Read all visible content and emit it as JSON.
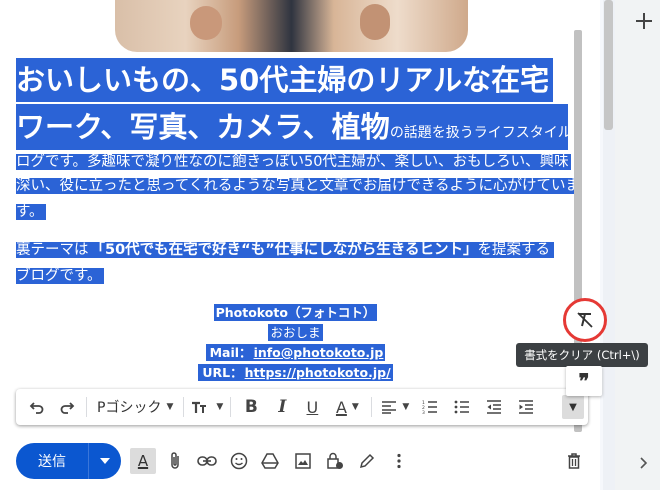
{
  "body": {
    "title_line1": "おいしいもの、50代主婦のリアルな在宅",
    "title_line2_big": "ワーク、写真、カメラ、植物",
    "title_line2_small": "の話題を扱うライフスタイルブ",
    "para1": [
      "ログです。多趣味で凝り性なのに飽きっぽい50代主婦が、楽しい、おもしろい、興味",
      "深い、役に立ったと思ってくれるような写真と文章でお届けできるように心がけていま",
      "す。"
    ],
    "para2_pre": "裏テーマは",
    "para2_bold": "「50代でも在宅で好き“も”仕事にしながら生きるヒント」",
    "para2_post": "を提案する",
    "para2_line2": "ブログです。",
    "signature": {
      "name": "Photokoto（フォトコト）",
      "author": "おおしま",
      "mail_label": "Mail：",
      "mail": "info@photokoto.jp",
      "url_label": "URL：",
      "url": "https://photokoto.jp/"
    }
  },
  "toolbar": {
    "font": "Pゴシック",
    "undo_icon": "undo-icon",
    "redo_icon": "redo-icon"
  },
  "clear_format_tooltip": "書式をクリア (Ctrl+\\)",
  "quote_glyph": "❞",
  "actions": {
    "send_label": "送信"
  },
  "colors": {
    "selection": "#2b63d6",
    "send": "#0b57d0",
    "highlight_ring": "#e53935"
  }
}
